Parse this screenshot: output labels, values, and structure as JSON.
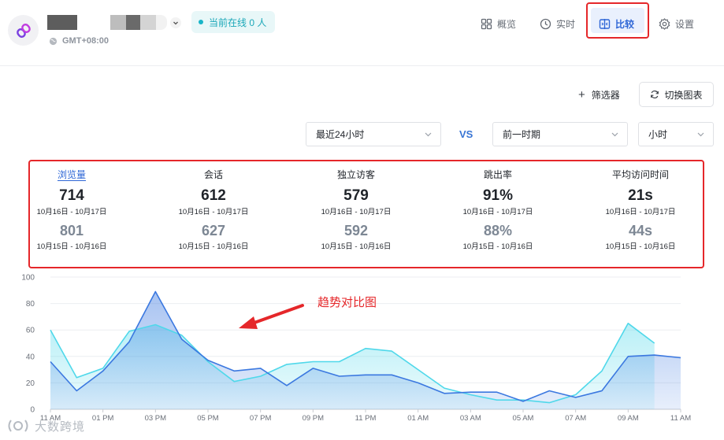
{
  "header": {
    "timezone": "GMT+08:00",
    "online": "当前在线 0 人",
    "nav": [
      {
        "key": "overview",
        "label": "概览",
        "icon": "grid-icon"
      },
      {
        "key": "realtime",
        "label": "实时",
        "icon": "clock-icon"
      },
      {
        "key": "compare",
        "label": "比较",
        "icon": "compare-icon",
        "active": true
      },
      {
        "key": "settings",
        "label": "设置",
        "icon": "gear-icon"
      }
    ]
  },
  "toolbar": {
    "filter_label": "筛选器",
    "switch_chart_label": "切换图表",
    "range_select": "最近24小时",
    "vs_label": "VS",
    "compare_select": "前一时期",
    "granularity_select": "小时"
  },
  "metrics": [
    {
      "name": "浏览量",
      "current": "714",
      "current_range": "10月16日 - 10月17日",
      "previous": "801",
      "previous_range": "10月15日 - 10月16日"
    },
    {
      "name": "会话",
      "current": "612",
      "current_range": "10月16日 - 10月17日",
      "previous": "627",
      "previous_range": "10月15日 - 10月16日"
    },
    {
      "name": "独立访客",
      "current": "579",
      "current_range": "10月16日 - 10月17日",
      "previous": "592",
      "previous_range": "10月15日 - 10月16日"
    },
    {
      "name": "跳出率",
      "current": "91%",
      "current_range": "10月16日 - 10月17日",
      "previous": "88%",
      "previous_range": "10月15日 - 10月16日"
    },
    {
      "name": "平均访问时间",
      "current": "21s",
      "current_range": "10月16日 - 10月17日",
      "previous": "44s",
      "previous_range": "10月15日 - 10月16日"
    }
  ],
  "annotation": "趋势对比图",
  "watermark": "大数跨境",
  "colors": {
    "accent": "#2f67d6",
    "highlight_red": "#e5272a",
    "series_current": "#3b78e0",
    "series_previous": "#4fd8ea"
  },
  "chart_data": {
    "type": "area",
    "ylim": [
      0,
      100
    ],
    "yticks": [
      0,
      20,
      40,
      60,
      80,
      100
    ],
    "xtick_labels": [
      "11 AM",
      "01 PM",
      "03 PM",
      "05 PM",
      "07 PM",
      "09 PM",
      "11 PM",
      "01 AM",
      "03 AM",
      "05 AM",
      "07 AM",
      "09 AM",
      "11 AM"
    ],
    "x_hours": [
      0,
      1,
      2,
      3,
      4,
      5,
      6,
      7,
      8,
      9,
      10,
      11,
      12,
      13,
      14,
      15,
      16,
      17,
      18,
      19,
      20,
      21,
      22,
      23,
      24
    ],
    "series": [
      {
        "values": [
          36,
          14,
          29,
          51,
          89,
          53,
          37,
          29,
          31,
          18,
          31,
          25,
          26,
          26,
          20,
          12,
          13,
          13,
          6,
          14,
          9,
          14,
          40,
          41,
          39
        ]
      },
      {
        "values": [
          60,
          24,
          31,
          59,
          64,
          56,
          36,
          21,
          25,
          34,
          36,
          36,
          46,
          44,
          30,
          16,
          11,
          7,
          7,
          5,
          11,
          29,
          65,
          50
        ]
      }
    ]
  }
}
